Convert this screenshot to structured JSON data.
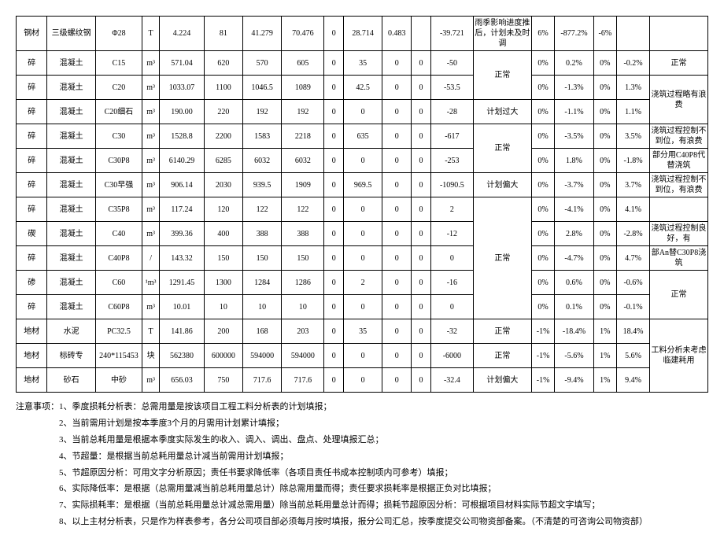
{
  "rows": [
    {
      "c": [
        "钢材",
        "三级螺纹钢",
        "Φ28",
        "T",
        "4.224",
        "81",
        "41.279",
        "70.476",
        "0",
        "28.714",
        "0.483",
        "",
        "-39.721",
        "雨季影响进度推后，计划未及时调",
        "6%",
        "-877.2%",
        "-6%",
        "",
        ""
      ]
    },
    {
      "c": [
        "碎",
        "混凝土",
        "C15",
        "m³",
        "571.04",
        "620",
        "570",
        "605",
        "0",
        "35",
        "0",
        "0",
        "-50",
        "正常",
        "0%",
        "0.2%",
        "0%",
        "-0.2%",
        "正常"
      ]
    },
    {
      "c": [
        "碎",
        "混凝土",
        "C20",
        "m³",
        "1033.07",
        "1100",
        "1046.5",
        "1089",
        "0",
        "42.5",
        "0",
        "0",
        "-53.5",
        "",
        "0%",
        "-1.3%",
        "0%",
        "1.3%",
        "浇筑过程略有浪费"
      ]
    },
    {
      "c": [
        "碎",
        "混凝土",
        "C20细石",
        "m³",
        "190.00",
        "220",
        "192",
        "192",
        "0",
        "0",
        "0",
        "0",
        "-28",
        "计划过大",
        "0%",
        "-1.1%",
        "0%",
        "1.1%",
        ""
      ]
    },
    {
      "c": [
        "碎",
        "混凝土",
        "C30",
        "m³",
        "1528.8",
        "2200",
        "1583",
        "2218",
        "0",
        "635",
        "0",
        "0",
        "-617",
        "正常",
        "0%",
        "-3.5%",
        "0%",
        "3.5%",
        "浇筑过程控制不到位，有浪费"
      ]
    },
    {
      "c": [
        "碎",
        "混凝土",
        "C30P8",
        "m³",
        "6140.29",
        "6285",
        "6032",
        "6032",
        "0",
        "0",
        "0",
        "0",
        "-253",
        "",
        "0%",
        "1.8%",
        "0%",
        "-1.8%",
        "部分用C40P8代替浇筑"
      ]
    },
    {
      "c": [
        "碎",
        "混凝土",
        "C30早强",
        "m³",
        "906.14",
        "2030",
        "939.5",
        "1909",
        "0",
        "969.5",
        "0",
        "0",
        "-1090.5",
        "计划偏大",
        "0%",
        "-3.7%",
        "0%",
        "3.7%",
        "浇筑过程控制不到位，有浪费"
      ]
    },
    {
      "c": [
        "碎",
        "混凝土",
        "C35P8",
        "m³",
        "117.24",
        "120",
        "122",
        "122",
        "0",
        "0",
        "0",
        "0",
        "2",
        "正常",
        "0%",
        "-4.1%",
        "0%",
        "4.1%",
        ""
      ]
    },
    {
      "c": [
        "碶",
        "混凝土",
        "C40",
        "m³",
        "399.36",
        "400",
        "388",
        "388",
        "0",
        "0",
        "0",
        "0",
        "-12",
        "",
        "0%",
        "2.8%",
        "0%",
        "-2.8%",
        "浇筑过程控制良好，有"
      ]
    },
    {
      "c": [
        "碎",
        "混凝土",
        "C40P8",
        "/",
        "143.32",
        "150",
        "150",
        "150",
        "0",
        "0",
        "0",
        "0",
        "0",
        "",
        "0%",
        "-4.7%",
        "0%",
        "4.7%",
        "部An替C30P8浇筑"
      ]
    },
    {
      "c": [
        "碜",
        "混凝土",
        "C60",
        "¹m³",
        "1291.45",
        "1300",
        "1284",
        "1286",
        "0",
        "2",
        "0",
        "0",
        "-16",
        "",
        "0%",
        "0.6%",
        "0%",
        "-0.6%",
        "正常"
      ]
    },
    {
      "c": [
        "碎",
        "混凝土",
        "C60P8",
        "m³",
        "10.01",
        "10",
        "10",
        "10",
        "0",
        "0",
        "0",
        "0",
        "0",
        "",
        "0%",
        "0.1%",
        "0%",
        "-0.1%",
        ""
      ]
    },
    {
      "c": [
        "地材",
        "水泥",
        "PC32.5",
        "T",
        "141.86",
        "200",
        "168",
        "203",
        "0",
        "35",
        "0",
        "0",
        "-32",
        "正常",
        "-1%",
        "-18.4%",
        "1%",
        "18.4%",
        "工料分析未考虑临建耗用"
      ]
    },
    {
      "c": [
        "地材",
        "标砖专",
        "240*115453",
        "块",
        "562380",
        "600000",
        "594000",
        "594000",
        "0",
        "0",
        "0",
        "0",
        "-6000",
        "正常",
        "-1%",
        "-5.6%",
        "1%",
        "5.6%",
        ""
      ]
    },
    {
      "c": [
        "地材",
        "砂石",
        "中砂",
        "m³",
        "656.03",
        "750",
        "717.6",
        "717.6",
        "0",
        "0",
        "0",
        "0",
        "-32.4",
        "计划偏大",
        "-1%",
        "-9.4%",
        "1%",
        "9.4%",
        ""
      ]
    }
  ],
  "notes": {
    "lead": "注意事项：",
    "n1": "1、季度损耗分析表：总需用量是按该项目工程工料分析表的计划填报；",
    "n2": "2、当前需用计划是按本季度3个月的月需用计划累计填报；",
    "n3": "3、当前总耗用量是根据本季度实际发生的收入、调入、调出、盘点、处理填报汇总；",
    "n4": "4、节超量：是根据当前总耗用量总计减当前需用计划填报；",
    "n5": "5、节超原因分析：可用文字分析原因；责任书要求降低率（各项目责任书成本控制项内可参考）填报；",
    "n6": "6、实际降低率：是根据（总需用量减当前总耗用量总计）除总需用量而得；责任要求损耗率是根据正负对比填报；",
    "n7": "7、实际损耗率：是根据（当前总耗用量总计减总需用量）除当前总耗用量总计而得；损耗节超原因分析：可根据项目材料实际节超文字填写；",
    "n8": "8、以上主材分析表，只是作为样表参考，各分公司项目部必须每月按时填报，报分公司汇总，按季度提交公司物资部备案。（不清楚的可咨询公司物资部）"
  }
}
